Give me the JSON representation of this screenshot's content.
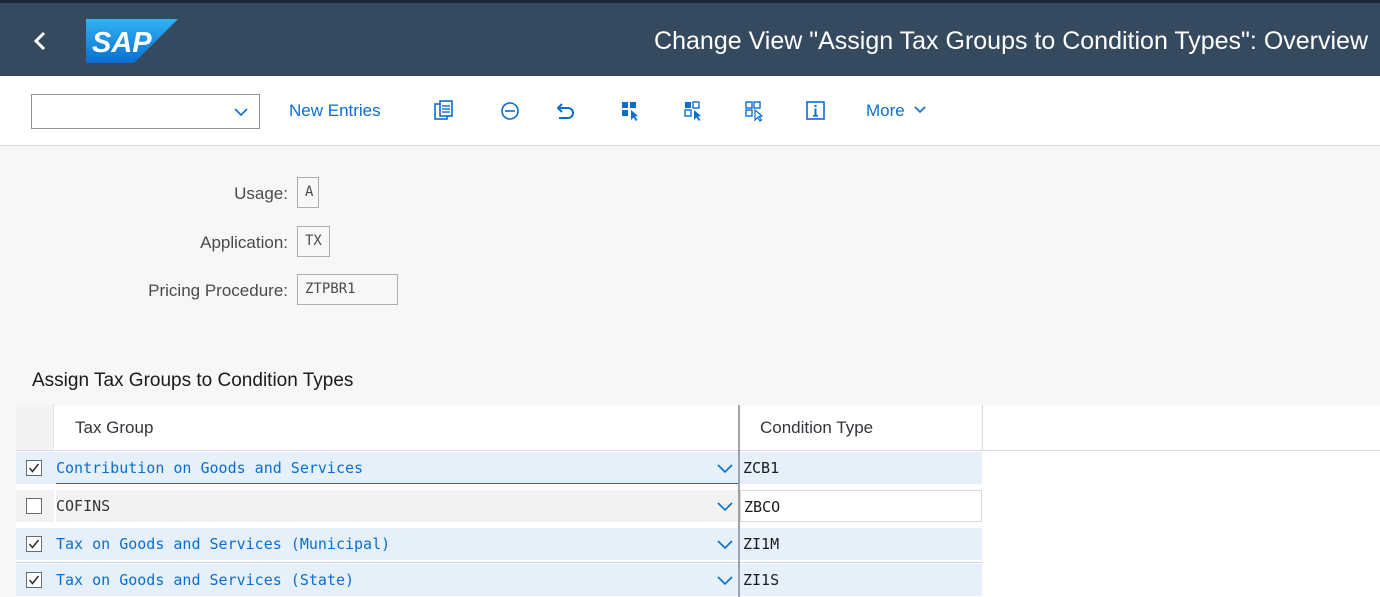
{
  "shell": {
    "title": "Change View \"Assign Tax Groups to Condition Types\": Overview",
    "logo_text": "SAP",
    "back_icon": "chevron-left-icon"
  },
  "toolbar": {
    "command_field_value": "",
    "new_entries_label": "New Entries",
    "more_label": "More",
    "icons": [
      "copy-icon",
      "delete-icon",
      "undo-icon",
      "select-all-icon",
      "select-block-icon",
      "deselect-all-icon",
      "info-icon"
    ]
  },
  "header": {
    "usage_label": "Usage:",
    "usage_value": "A",
    "application_label": "Application:",
    "application_value": "TX",
    "pricing_label": "Pricing Procedure:",
    "pricing_value": "ZTPBR1"
  },
  "table": {
    "title": "Assign Tax Groups to Condition Types",
    "columns": [
      "Tax Group",
      "Condition Type"
    ],
    "rows": [
      {
        "selected": true,
        "tax_group": "Contribution on Goods and Services",
        "condition_type": "ZCB1"
      },
      {
        "selected": false,
        "tax_group": "COFINS",
        "condition_type": "ZBCO"
      },
      {
        "selected": true,
        "tax_group": "Tax on Goods and Services (Municipal)",
        "condition_type": "ZI1M"
      },
      {
        "selected": true,
        "tax_group": "Tax on Goods and Services (State)",
        "condition_type": "ZI1S"
      }
    ]
  },
  "colors": {
    "shell_bg": "#354a5f",
    "accent": "#0a6ed1",
    "selected_row": "#e5f0fa"
  }
}
